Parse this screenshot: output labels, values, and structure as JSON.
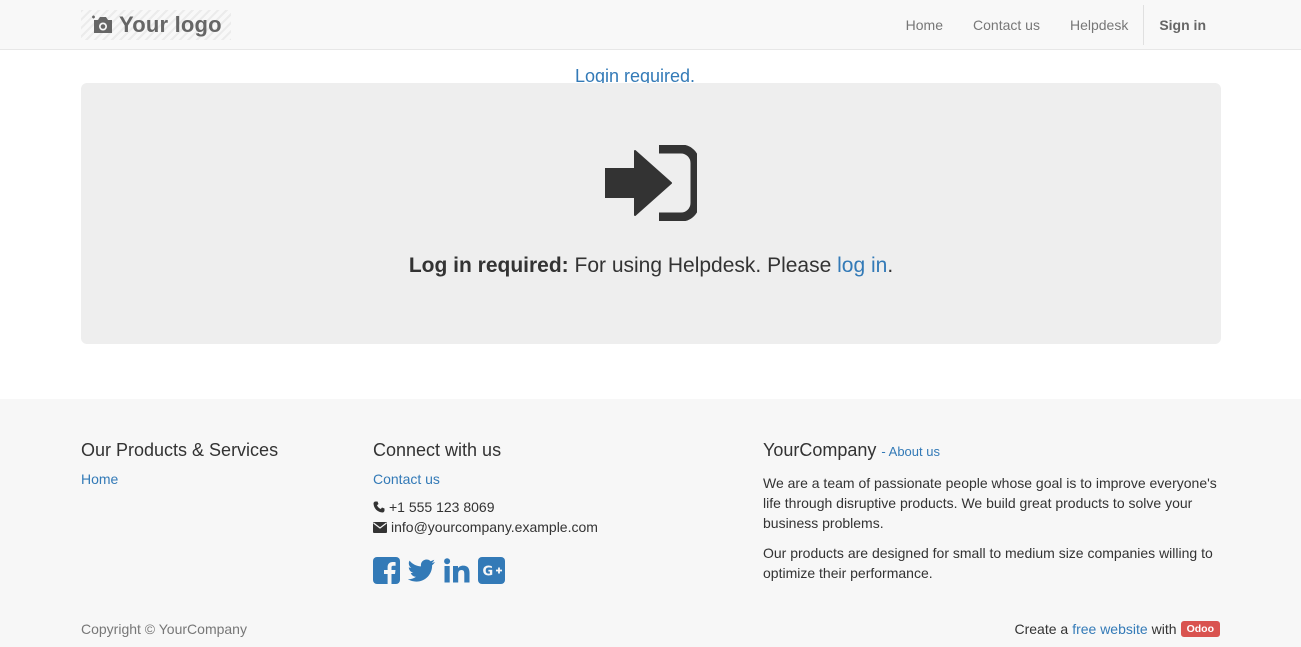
{
  "header": {
    "logo_text": "Your logo",
    "nav": [
      "Home",
      "Contact us",
      "Helpdesk"
    ],
    "sign_in": "Sign in"
  },
  "main": {
    "title": "Login required.",
    "message_bold": "Log in required:",
    "message_text": " For using Helpdesk. Please ",
    "message_link": "log in",
    "message_end": "."
  },
  "footer": {
    "products": {
      "heading": "Our Products & Services",
      "link": "Home"
    },
    "connect": {
      "heading": "Connect with us",
      "link": "Contact us",
      "phone": "+1 555 123 8069",
      "email": "info@yourcompany.example.com",
      "social": [
        "facebook-icon",
        "twitter-icon",
        "linkedin-icon",
        "google-plus-icon"
      ]
    },
    "company": {
      "name": "YourCompany",
      "about_link": "- About us",
      "para1": "We are a team of passionate people whose goal is to improve everyone's life through disruptive products. We build great products to solve your business problems.",
      "para2": "Our products are designed for small to medium size companies willing to optimize their performance."
    },
    "copyright": "Copyright © YourCompany",
    "powered": {
      "prefix": "Create a",
      "link": "free website",
      "middle": "with",
      "badge": "Odoo"
    }
  },
  "colors": {
    "link": "#337ab7",
    "jumbotron": "#eeeeee",
    "badge": "#d9534f"
  }
}
